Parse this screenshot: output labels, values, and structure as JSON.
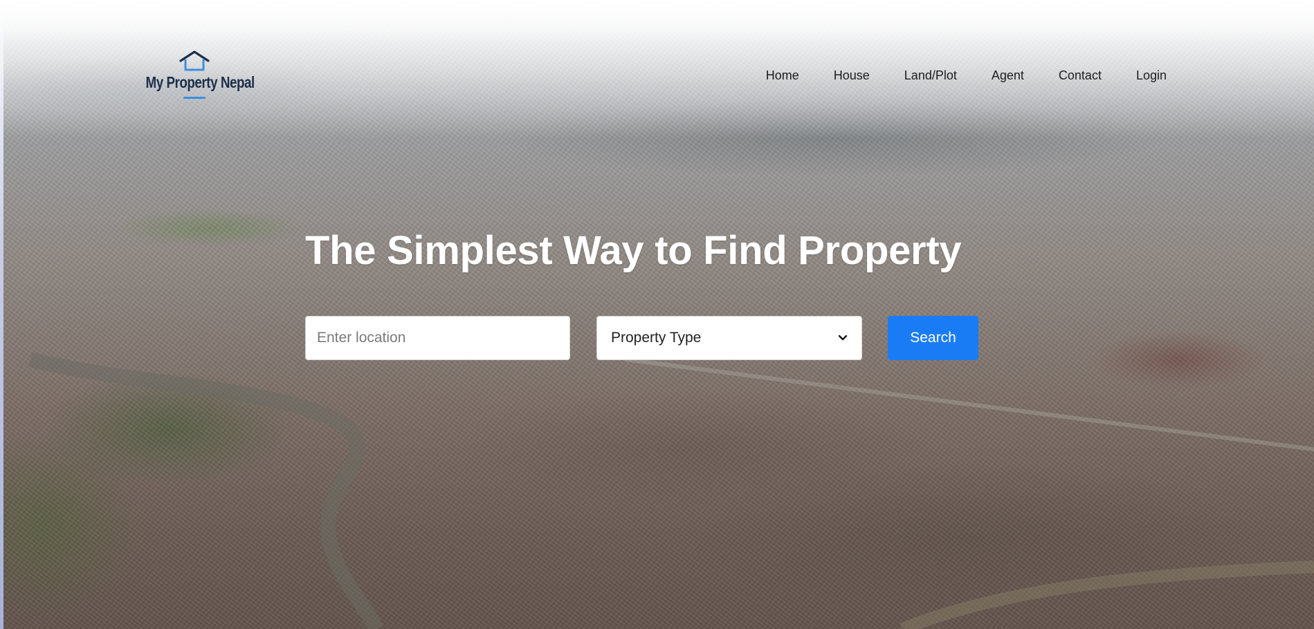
{
  "brand": {
    "name": "My Property Nepal",
    "logo_icon": "house-icon",
    "accent_color": "#3d8ee0",
    "text_color": "#1d2f4a"
  },
  "nav": {
    "items": [
      {
        "label": "Home"
      },
      {
        "label": "House"
      },
      {
        "label": "Land/Plot"
      },
      {
        "label": "Agent"
      },
      {
        "label": "Contact"
      },
      {
        "label": "Login"
      }
    ]
  },
  "hero": {
    "title": "The Simplest Way to Find Property",
    "background": "aerial-city-photo"
  },
  "search": {
    "location_placeholder": "Enter location",
    "location_value": "",
    "property_type_selected": "Property Type",
    "button_label": "Search",
    "button_color": "#1a7cf5"
  }
}
